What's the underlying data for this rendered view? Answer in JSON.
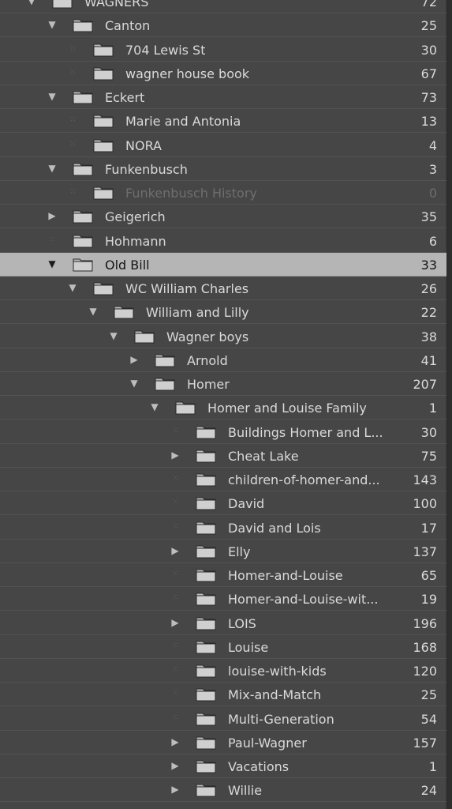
{
  "folders": [
    {
      "name": "WAGNERS",
      "count": "72",
      "depth": 0,
      "toggle": "expanded"
    },
    {
      "name": "Canton",
      "count": "25",
      "depth": 1,
      "toggle": "expanded"
    },
    {
      "name": "704 Lewis St",
      "count": "30",
      "depth": 2,
      "toggle": "leaf"
    },
    {
      "name": "wagner house book",
      "count": "67",
      "depth": 2,
      "toggle": "leaf"
    },
    {
      "name": "Eckert",
      "count": "73",
      "depth": 1,
      "toggle": "expanded"
    },
    {
      "name": "Marie and Antonia",
      "count": "13",
      "depth": 2,
      "toggle": "leaf"
    },
    {
      "name": "NORA",
      "count": "4",
      "depth": 2,
      "toggle": "leaf"
    },
    {
      "name": "Funkenbusch",
      "count": "3",
      "depth": 1,
      "toggle": "expanded"
    },
    {
      "name": "Funkenbusch History",
      "count": "0",
      "depth": 2,
      "toggle": "leaf",
      "dim": true
    },
    {
      "name": "Geigerich",
      "count": "35",
      "depth": 1,
      "toggle": "collapsed"
    },
    {
      "name": "Hohmann",
      "count": "6",
      "depth": 1,
      "toggle": "leaf"
    },
    {
      "name": "Old Bill",
      "count": "33",
      "depth": 1,
      "toggle": "expanded",
      "selected": true
    },
    {
      "name": "WC William Charles",
      "count": "26",
      "depth": 2,
      "toggle": "expanded"
    },
    {
      "name": "William and Lilly",
      "count": "22",
      "depth": 3,
      "toggle": "expanded"
    },
    {
      "name": "Wagner boys",
      "count": "38",
      "depth": 4,
      "toggle": "expanded"
    },
    {
      "name": "Arnold",
      "count": "41",
      "depth": 5,
      "toggle": "collapsed"
    },
    {
      "name": "Homer",
      "count": "207",
      "depth": 5,
      "toggle": "expanded"
    },
    {
      "name": "Homer and Louise Family",
      "count": "1",
      "depth": 6,
      "toggle": "expanded"
    },
    {
      "name": "Buildings Homer and L...",
      "count": "30",
      "depth": 7,
      "toggle": "leaf"
    },
    {
      "name": "Cheat Lake",
      "count": "75",
      "depth": 7,
      "toggle": "collapsed"
    },
    {
      "name": "children-of-homer-and...",
      "count": "143",
      "depth": 7,
      "toggle": "leaf"
    },
    {
      "name": "David",
      "count": "100",
      "depth": 7,
      "toggle": "leaf"
    },
    {
      "name": "David and Lois",
      "count": "17",
      "depth": 7,
      "toggle": "leaf"
    },
    {
      "name": "Elly",
      "count": "137",
      "depth": 7,
      "toggle": "collapsed"
    },
    {
      "name": "Homer-and-Louise",
      "count": "65",
      "depth": 7,
      "toggle": "leaf"
    },
    {
      "name": "Homer-and-Louise-wit...",
      "count": "19",
      "depth": 7,
      "toggle": "leaf"
    },
    {
      "name": "LOIS",
      "count": "196",
      "depth": 7,
      "toggle": "collapsed"
    },
    {
      "name": "Louise",
      "count": "168",
      "depth": 7,
      "toggle": "leaf"
    },
    {
      "name": "louise-with-kids",
      "count": "120",
      "depth": 7,
      "toggle": "leaf"
    },
    {
      "name": "Mix-and-Match",
      "count": "25",
      "depth": 7,
      "toggle": "leaf"
    },
    {
      "name": "Multi-Generation",
      "count": "54",
      "depth": 7,
      "toggle": "leaf"
    },
    {
      "name": "Paul-Wagner",
      "count": "157",
      "depth": 7,
      "toggle": "collapsed"
    },
    {
      "name": "Vacations",
      "count": "1",
      "depth": 7,
      "toggle": "collapsed"
    },
    {
      "name": "Willie",
      "count": "24",
      "depth": 7,
      "toggle": "collapsed"
    }
  ],
  "icons": {
    "expanded": "disclosure-triangle-down-icon",
    "collapsed": "disclosure-triangle-right-icon",
    "leaf": "dotted-leaf-marker-icon",
    "folder": "folder-icon"
  },
  "colors": {
    "panel_background": "#464646",
    "row_divider": "#525252",
    "text": "#dadada",
    "selected_background": "#b5b5b5",
    "selected_text": "#141414",
    "dim_text": "#6e6e6e",
    "folder_fill": "#cfcfcf"
  }
}
